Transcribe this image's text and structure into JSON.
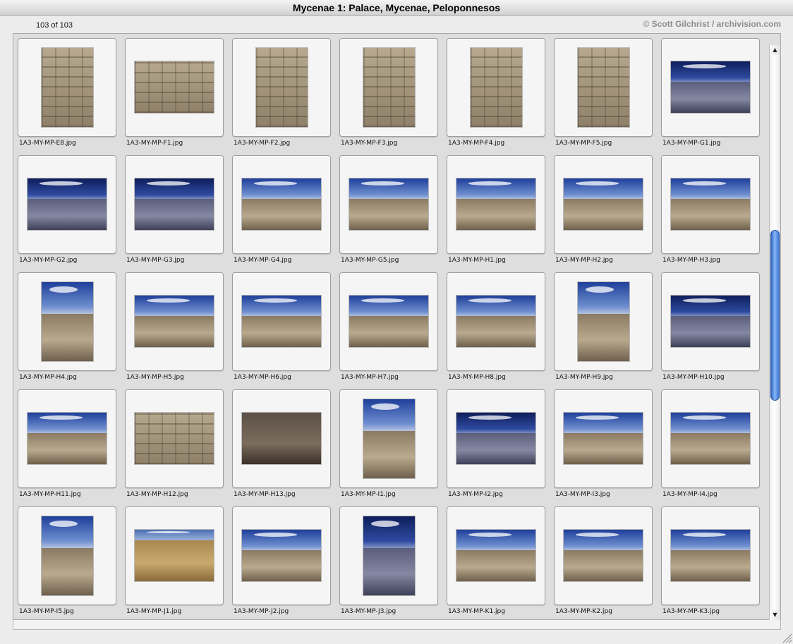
{
  "window": {
    "title": "Mycenae 1: Palace, Mycenae, Peloponnesos"
  },
  "header": {
    "counter": "103 of 103",
    "credit": "© Scott Gilchrist / archivision.com"
  },
  "scrollbar": {
    "up_arrow": "▲",
    "down_arrow": "▼",
    "position": 0.5
  },
  "images": [
    {
      "name": "1A3-MY-MP-E8.jpg",
      "orientation": "portrait",
      "style": "stone"
    },
    {
      "name": "1A3-MY-MP-F1.jpg",
      "orientation": "landscape",
      "style": "stone"
    },
    {
      "name": "1A3-MY-MP-F2.jpg",
      "orientation": "portrait",
      "style": "stone"
    },
    {
      "name": "1A3-MY-MP-F3.jpg",
      "orientation": "portrait",
      "style": "stone"
    },
    {
      "name": "1A3-MY-MP-F4.jpg",
      "orientation": "portrait",
      "style": "stone"
    },
    {
      "name": "1A3-MY-MP-F5.jpg",
      "orientation": "portrait",
      "style": "stone"
    },
    {
      "name": "1A3-MY-MP-G1.jpg",
      "orientation": "landscape",
      "style": "night"
    },
    {
      "name": "1A3-MY-MP-G2.jpg",
      "orientation": "landscape",
      "style": "night"
    },
    {
      "name": "1A3-MY-MP-G3.jpg",
      "orientation": "landscape",
      "style": "night"
    },
    {
      "name": "1A3-MY-MP-G4.jpg",
      "orientation": "landscape",
      "style": "sky"
    },
    {
      "name": "1A3-MY-MP-G5.jpg",
      "orientation": "landscape",
      "style": "sky"
    },
    {
      "name": "1A3-MY-MP-H1.jpg",
      "orientation": "landscape",
      "style": "sky"
    },
    {
      "name": "1A3-MY-MP-H2.jpg",
      "orientation": "landscape",
      "style": "sky"
    },
    {
      "name": "1A3-MY-MP-H3.jpg",
      "orientation": "landscape",
      "style": "sky"
    },
    {
      "name": "1A3-MY-MP-H4.jpg",
      "orientation": "portrait",
      "style": "sky"
    },
    {
      "name": "1A3-MY-MP-H5.jpg",
      "orientation": "landscape",
      "style": "sky"
    },
    {
      "name": "1A3-MY-MP-H6.jpg",
      "orientation": "landscape",
      "style": "sky"
    },
    {
      "name": "1A3-MY-MP-H7.jpg",
      "orientation": "landscape",
      "style": "sky"
    },
    {
      "name": "1A3-MY-MP-H8.jpg",
      "orientation": "landscape",
      "style": "sky"
    },
    {
      "name": "1A3-MY-MP-H9.jpg",
      "orientation": "portrait",
      "style": "sky"
    },
    {
      "name": "1A3-MY-MP-H10.jpg",
      "orientation": "landscape",
      "style": "night"
    },
    {
      "name": "1A3-MY-MP-H11.jpg",
      "orientation": "landscape",
      "style": "sky"
    },
    {
      "name": "1A3-MY-MP-H12.jpg",
      "orientation": "landscape",
      "style": "stone"
    },
    {
      "name": "1A3-MY-MP-H13.jpg",
      "orientation": "landscape",
      "style": "dark"
    },
    {
      "name": "1A3-MY-MP-I1.jpg",
      "orientation": "portrait",
      "style": "sky"
    },
    {
      "name": "1A3-MY-MP-I2.jpg",
      "orientation": "landscape",
      "style": "night"
    },
    {
      "name": "1A3-MY-MP-I3.jpg",
      "orientation": "landscape",
      "style": "sky"
    },
    {
      "name": "1A3-MY-MP-I4.jpg",
      "orientation": "landscape",
      "style": "sky"
    },
    {
      "name": "1A3-MY-MP-I5.jpg",
      "orientation": "portrait",
      "style": "sky"
    },
    {
      "name": "1A3-MY-MP-J1.jpg",
      "orientation": "landscape",
      "style": "dry"
    },
    {
      "name": "1A3-MY-MP-J2.jpg",
      "orientation": "landscape",
      "style": "sky"
    },
    {
      "name": "1A3-MY-MP-J3.jpg",
      "orientation": "portrait",
      "style": "night"
    },
    {
      "name": "1A3-MY-MP-K1.jpg",
      "orientation": "landscape",
      "style": "sky"
    },
    {
      "name": "1A3-MY-MP-K2.jpg",
      "orientation": "landscape",
      "style": "sky"
    },
    {
      "name": "1A3-MY-MP-K3.jpg",
      "orientation": "landscape",
      "style": "sky"
    }
  ]
}
